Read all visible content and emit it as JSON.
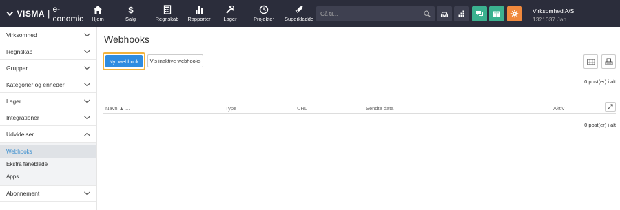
{
  "brand": {
    "name": "VISMA",
    "separator": "|",
    "app": "e-conomic"
  },
  "nav": [
    {
      "label": "Hjem",
      "icon": "home-icon"
    },
    {
      "label": "Salg",
      "icon": "dollar-icon"
    },
    {
      "label": "Regnskab",
      "icon": "calculator-icon"
    },
    {
      "label": "Rapporter",
      "icon": "bar-chart-icon"
    },
    {
      "label": "Lager",
      "icon": "tools-icon"
    },
    {
      "label": "Projekter",
      "icon": "clock-icon"
    },
    {
      "label": "Superkladde",
      "icon": "rocket-icon"
    }
  ],
  "search": {
    "placeholder": "Gå til..."
  },
  "company": {
    "name": "Virksomhed A/S",
    "user": "1321037 Jan"
  },
  "colors": {
    "topbar": "#2b2d3b",
    "chat": "#3bb18f",
    "book": "#3bb18f",
    "gear": "#f0893d",
    "primary": "#2f8ce0",
    "highlight": "#f2b33d",
    "active_link": "#3a8ecf"
  },
  "sidebar": {
    "items": [
      {
        "label": "Virksomhed",
        "expanded": false
      },
      {
        "label": "Regnskab",
        "expanded": false
      },
      {
        "label": "Grupper",
        "expanded": false
      },
      {
        "label": "Kategorier og enheder",
        "expanded": false
      },
      {
        "label": "Lager",
        "expanded": false
      },
      {
        "label": "Integrationer",
        "expanded": false
      },
      {
        "label": "Udvidelser",
        "expanded": true
      }
    ],
    "sub_items": [
      {
        "label": "Webhooks",
        "active": true
      },
      {
        "label": "Ekstra faneblade",
        "active": false
      },
      {
        "label": "Apps",
        "active": false
      }
    ],
    "after": [
      {
        "label": "Abonnement",
        "expanded": false
      }
    ]
  },
  "main": {
    "title": "Webhooks",
    "primary_button": "Nyt webhook",
    "secondary_button": "Vis inaktive webhooks",
    "count_top": "0 post(er) i alt",
    "count_bottom": "0 post(er) i alt",
    "columns": [
      "Navn ▲ ...",
      "Type",
      "URL",
      "Sendte data",
      "Aktiv"
    ]
  }
}
